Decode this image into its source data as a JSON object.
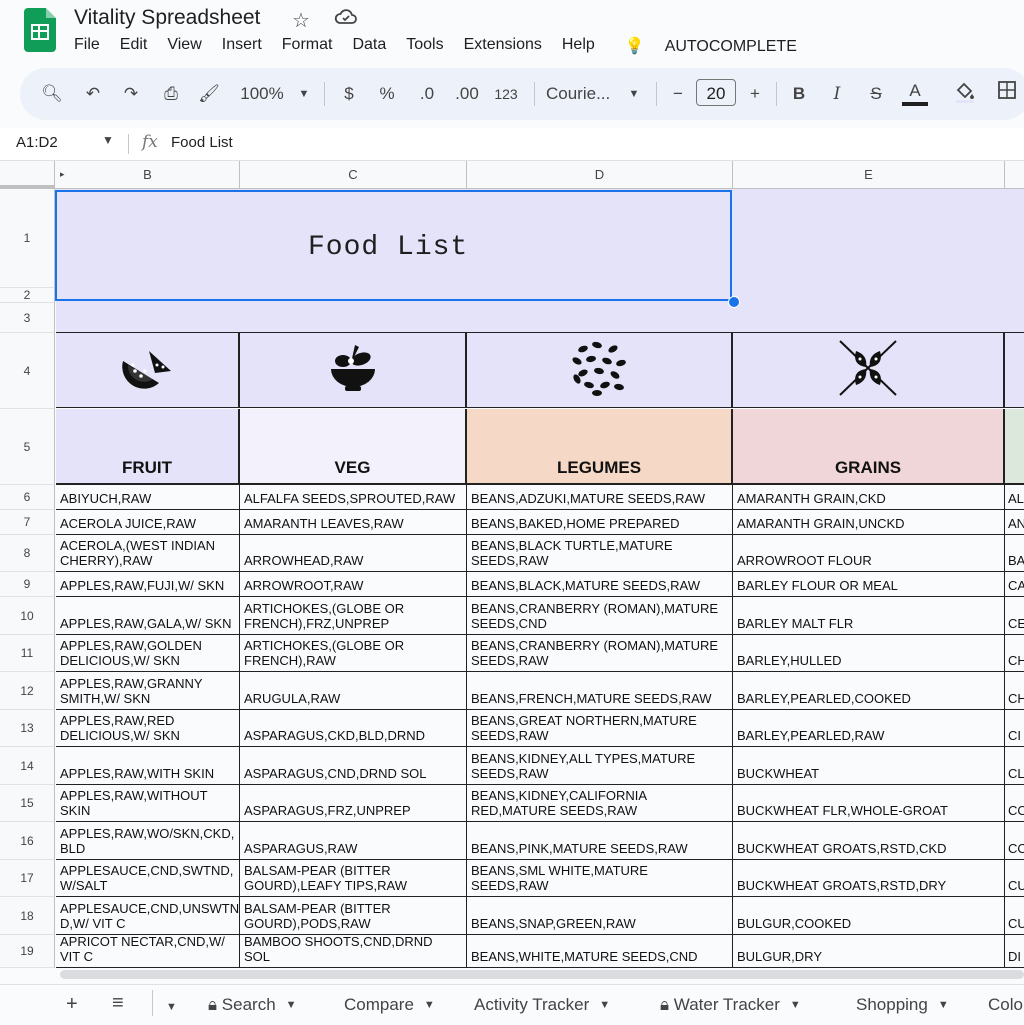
{
  "app": {
    "title": "Vitality Spreadsheet",
    "menus": [
      "File",
      "Edit",
      "View",
      "Insert",
      "Format",
      "Data",
      "Tools",
      "Extensions",
      "Help"
    ],
    "autocomplete_label": "AUTOCOMPLETE"
  },
  "toolbar": {
    "zoom": "100%",
    "currency": "$",
    "percent": "%",
    "dec_decrease": ".0",
    "dec_increase": ".00",
    "number_format": "123",
    "font": "Courie...",
    "font_size": "20",
    "bold": "B",
    "italic": "I",
    "text_color": "A"
  },
  "formula": {
    "name_box": "A1:D2",
    "fx": "fx",
    "value": "Food List"
  },
  "columns": [
    "B",
    "C",
    "D",
    "E"
  ],
  "rows": [
    "1",
    "2",
    "3",
    "4",
    "5",
    "6",
    "7",
    "8",
    "9",
    "10",
    "11",
    "12",
    "13",
    "14",
    "15",
    "16",
    "17",
    "18",
    "19"
  ],
  "sheet": {
    "title": "Food List",
    "categories": [
      {
        "label": "FRUIT",
        "icon": "watermelon-icon",
        "color": "#e5e3f9"
      },
      {
        "label": "VEG",
        "icon": "salad-bowl-icon",
        "color": "#f3f1fb"
      },
      {
        "label": "LEGUMES",
        "icon": "beans-icon",
        "color": "#f5d9c6"
      },
      {
        "label": "GRAINS",
        "icon": "grains-icon",
        "color": "#f0d6d8"
      }
    ],
    "fruit": [
      "ABIYUCH,RAW",
      "ACEROLA JUICE,RAW",
      "ACEROLA,(WEST INDIAN CHERRY),RAW",
      "APPLES,RAW,FUJI,W/ SKN",
      "APPLES,RAW,GALA,W/ SKN",
      "APPLES,RAW,GOLDEN DELICIOUS,W/ SKN",
      "APPLES,RAW,GRANNY SMITH,W/ SKN",
      "APPLES,RAW,RED DELICIOUS,W/ SKN",
      "APPLES,RAW,WITH SKIN",
      "APPLES,RAW,WITHOUT SKIN",
      "APPLES,RAW,WO/SKN,CKD, BLD",
      "APPLESAUCE,CND,SWTND, W/SALT",
      "APPLESAUCE,CND,UNSWTN D,W/ VIT C",
      "APRICOT NECTAR,CND,W/ VIT C"
    ],
    "veg": [
      "ALFALFA SEEDS,SPROUTED,RAW",
      "AMARANTH LEAVES,RAW",
      "ARROWHEAD,RAW",
      "ARROWROOT,RAW",
      "ARTICHOKES,(GLOBE OR FRENCH),FRZ,UNPREP",
      "ARTICHOKES,(GLOBE OR FRENCH),RAW",
      "ARUGULA,RAW",
      "ASPARAGUS,CKD,BLD,DRND",
      "ASPARAGUS,CND,DRND SOL",
      "ASPARAGUS,FRZ,UNPREP",
      "ASPARAGUS,RAW",
      "BALSAM-PEAR (BITTER GOURD),LEAFY TIPS,RAW",
      "BALSAM-PEAR (BITTER GOURD),PODS,RAW",
      "BAMBOO SHOOTS,CND,DRND SOL"
    ],
    "legumes": [
      "BEANS,ADZUKI,MATURE SEEDS,RAW",
      "BEANS,BAKED,HOME PREPARED",
      "BEANS,BLACK TURTLE,MATURE SEEDS,RAW",
      "BEANS,BLACK,MATURE SEEDS,RAW",
      "BEANS,CRANBERRY (ROMAN),MATURE SEEDS,CND",
      "BEANS,CRANBERRY (ROMAN),MATURE SEEDS,RAW",
      "BEANS,FRENCH,MATURE SEEDS,RAW",
      "BEANS,GREAT NORTHERN,MATURE SEEDS,RAW",
      "BEANS,KIDNEY,ALL TYPES,MATURE SEEDS,RAW",
      "BEANS,KIDNEY,CALIFORNIA RED,MATURE SEEDS,RAW",
      "BEANS,PINK,MATURE SEEDS,RAW",
      "BEANS,SML WHITE,MATURE SEEDS,RAW",
      "BEANS,SNAP,GREEN,RAW",
      "BEANS,WHITE,MATURE SEEDS,CND"
    ],
    "grains": [
      "AMARANTH GRAIN,CKD",
      "AMARANTH GRAIN,UNCKD",
      "ARROWROOT FLOUR",
      "BARLEY FLOUR OR MEAL",
      "BARLEY MALT FLR",
      "BARLEY,HULLED",
      "BARLEY,PEARLED,COOKED",
      "BARLEY,PEARLED,RAW",
      "BUCKWHEAT",
      "BUCKWHEAT FLR,WHOLE-GROAT",
      "BUCKWHEAT GROATS,RSTD,CKD",
      "BUCKWHEAT GROATS,RSTD,DRY",
      "BULGUR,COOKED",
      "BULGUR,DRY"
    ],
    "next_col": [
      "AL",
      "AN",
      "BA",
      "CA",
      "CE",
      "CH",
      "CH",
      "CI",
      "CL",
      "CO",
      "CO",
      "CU",
      "CU",
      "DI"
    ]
  },
  "tabs": [
    "Search",
    "Compare",
    "Activity Tracker",
    "Water Tracker",
    "Shopping",
    "Colo"
  ]
}
